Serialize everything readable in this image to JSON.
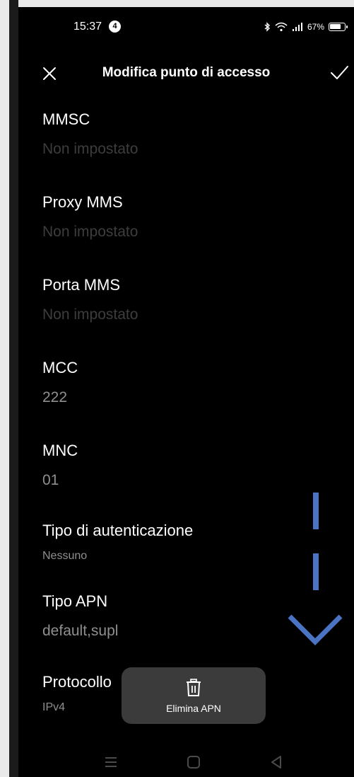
{
  "status_bar": {
    "time": "15:37",
    "notification_count": "4",
    "battery": "67%"
  },
  "app_bar": {
    "title": "Modifica punto di accesso",
    "close_icon": "close-icon",
    "save_icon": "check-icon"
  },
  "fields": [
    {
      "label": "MMSC",
      "value": "Non impostato"
    },
    {
      "label": "Proxy MMS",
      "value": "Non impostato"
    },
    {
      "label": "Porta MMS",
      "value": "Non impostato"
    },
    {
      "label": "MCC",
      "value": "222"
    },
    {
      "label": "MNC",
      "value": "01"
    },
    {
      "label": "Tipo di autenticazione",
      "value": "Nessuno"
    },
    {
      "label": "Tipo APN",
      "value": "default,supl"
    },
    {
      "label": "Protocollo",
      "value": "IPv4"
    }
  ],
  "toast": {
    "label": "Elimina APN",
    "icon": "trash-icon"
  },
  "overlay": {
    "icon": "scroll-down-arrow-icon",
    "color": "#4b73c4"
  },
  "nav_bar": {
    "items": [
      "menu-icon",
      "home-icon",
      "back-icon"
    ]
  }
}
